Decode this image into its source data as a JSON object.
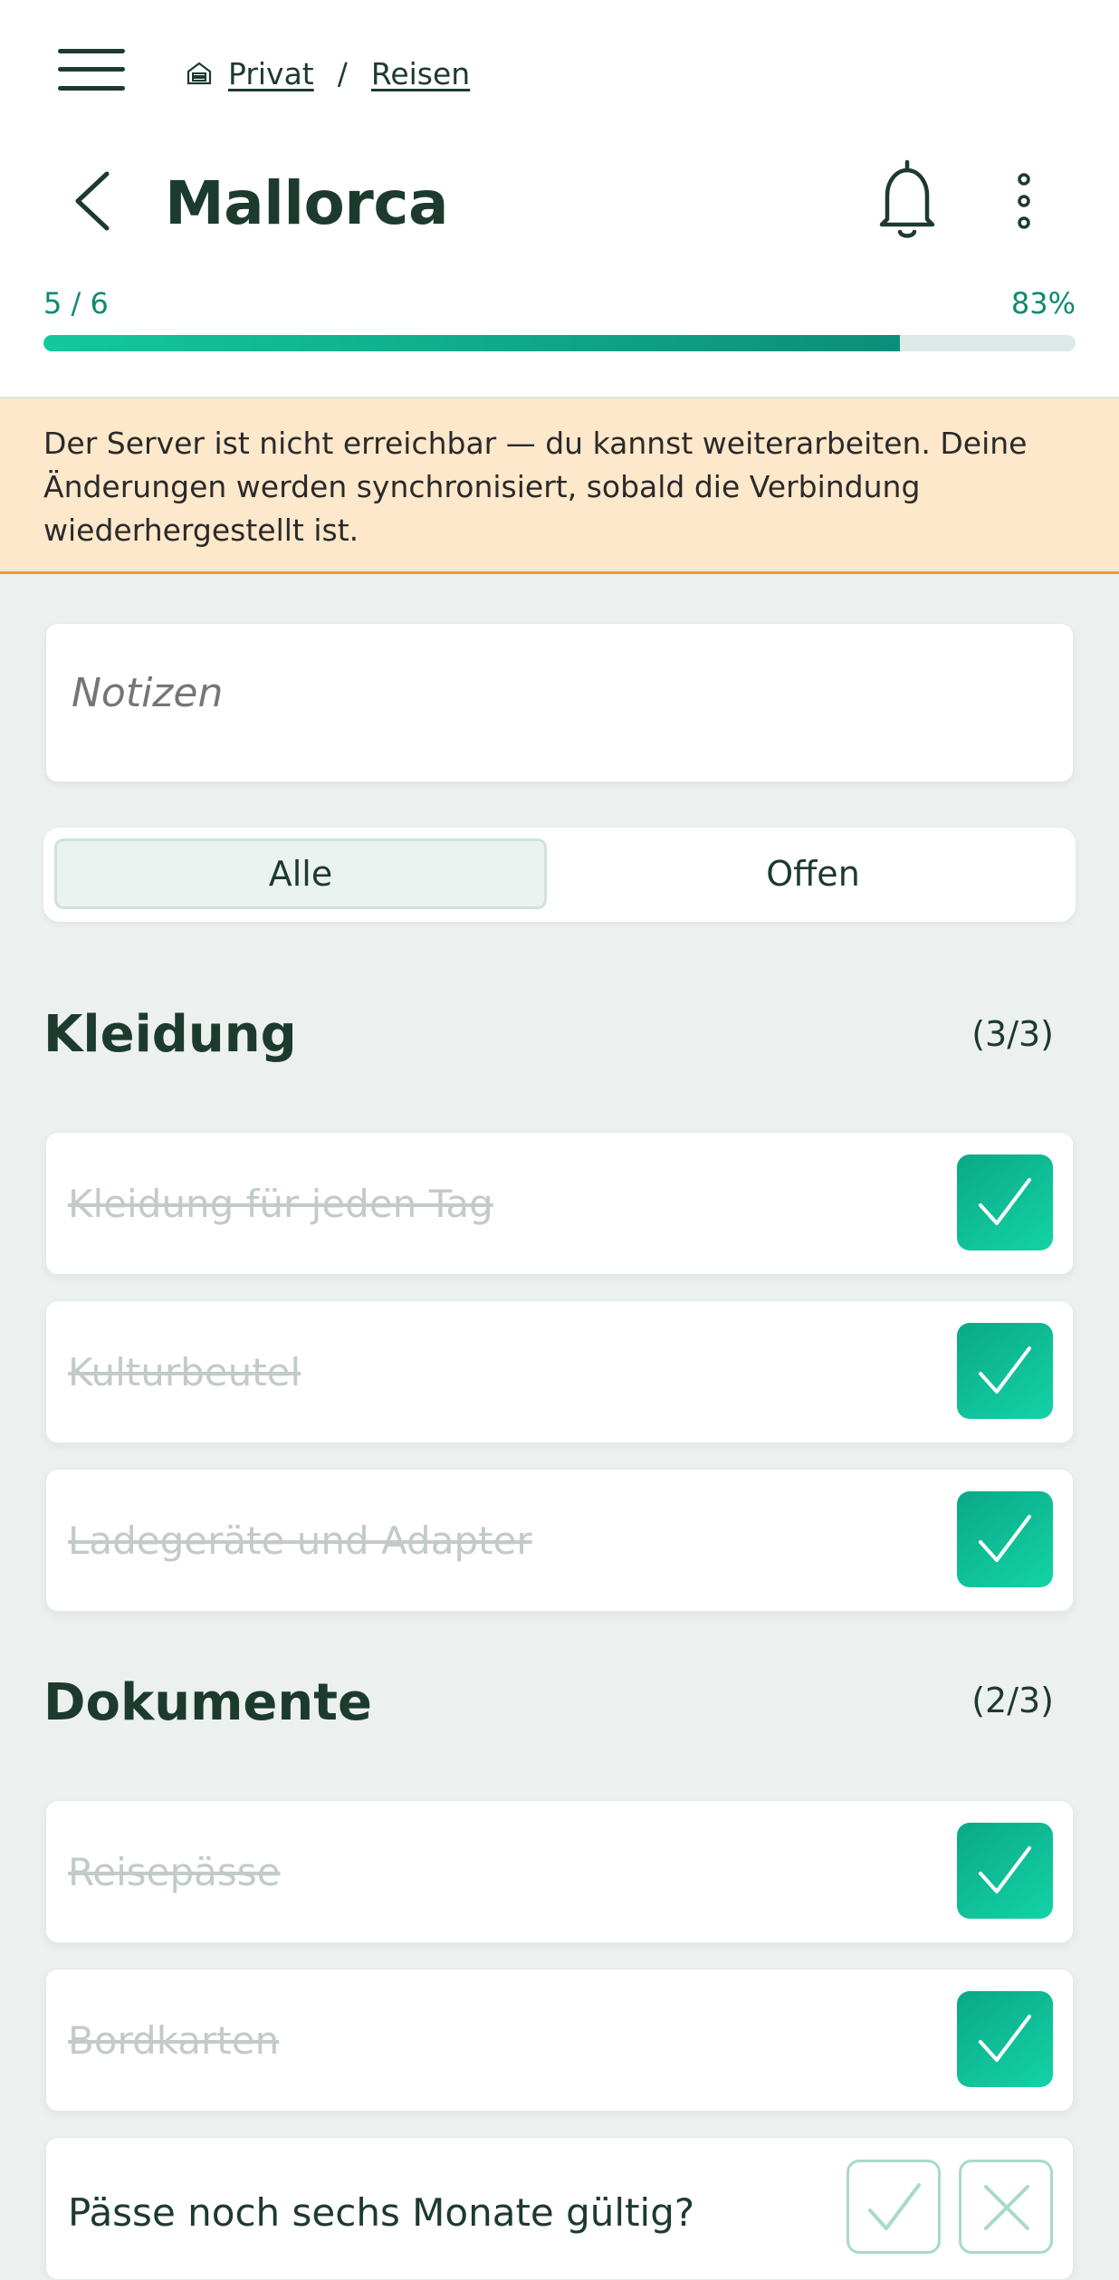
{
  "breadcrumb": {
    "items": [
      "Privat",
      "Reisen"
    ],
    "separator": "/"
  },
  "header": {
    "title": "Mallorca"
  },
  "progress": {
    "count": "5 / 6",
    "percent_label": "83%",
    "fraction": 0.83
  },
  "banner": {
    "message": "Der Server ist nicht erreichbar — du kannst weiterarbeiten. Deine Änderungen werden synchronisiert, sobald die Verbindung wiederhergestellt ist."
  },
  "notes": {
    "placeholder": "Notizen"
  },
  "filter": {
    "options": [
      "Alle",
      "Offen"
    ],
    "selected": "Alle"
  },
  "sections": [
    {
      "title": "Kleidung",
      "count": "(3/3)",
      "items": [
        {
          "label": "Kleidung für jeden Tag",
          "checked": true
        },
        {
          "label": "Kulturbeutel",
          "checked": true
        },
        {
          "label": "Ladegeräte und Adapter",
          "checked": true
        }
      ]
    },
    {
      "title": "Dokumente",
      "count": "(2/3)",
      "items": [
        {
          "label": "Reisepässe",
          "checked": true
        },
        {
          "label": "Bordkarten",
          "checked": true
        },
        {
          "label": "Pässe noch sechs Monate gültig?",
          "checked": false
        }
      ]
    }
  ],
  "colors": {
    "accent": "#0ba887",
    "banner_bg": "#fde8cb",
    "banner_border": "#e89a3c",
    "text": "#1d3a2e"
  }
}
